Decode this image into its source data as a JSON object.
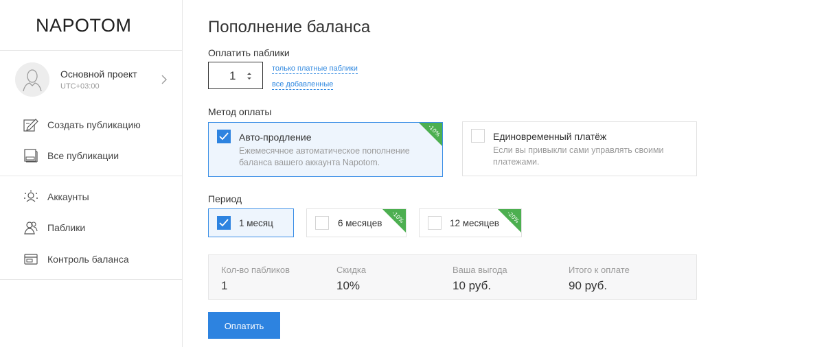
{
  "sidebar": {
    "logo": "NAPOTOM",
    "project": {
      "name": "Основной проект",
      "timezone": "UTC+03:00"
    },
    "nav_top": [
      {
        "label": "Создать публикацию",
        "icon": "edit-icon"
      },
      {
        "label": "Все публикации",
        "icon": "publications-icon"
      }
    ],
    "nav_bottom": [
      {
        "label": "Аккаунты",
        "icon": "accounts-icon"
      },
      {
        "label": "Паблики",
        "icon": "groups-icon"
      },
      {
        "label": "Контроль баланса",
        "icon": "wallet-icon"
      }
    ]
  },
  "main": {
    "title": "Пополнение баланса",
    "publics": {
      "label": "Оплатить паблики",
      "value": "1",
      "link_paid": "только платные паблики",
      "link_all": "все добавленные"
    },
    "method": {
      "label": "Метод оплаты",
      "options": [
        {
          "title": "Авто-продление",
          "desc": "Ежемесячное автоматическое пополнение баланса вашего аккаунта Napotom.",
          "badge": "-10%",
          "selected": true
        },
        {
          "title": "Единовременный платёж",
          "desc": "Если вы привыкли сами управлять своими платежами.",
          "badge": "",
          "selected": false
        }
      ]
    },
    "period": {
      "label": "Период",
      "options": [
        {
          "label": "1 месяц",
          "badge": "",
          "selected": true
        },
        {
          "label": "6 месяцев",
          "badge": "-10%",
          "selected": false
        },
        {
          "label": "12 месяцев",
          "badge": "-20%",
          "selected": false
        }
      ]
    },
    "summary": [
      {
        "label": "Кол-во пабликов",
        "value": "1"
      },
      {
        "label": "Скидка",
        "value": "10%"
      },
      {
        "label": "Ваша выгода",
        "value": "10 руб."
      },
      {
        "label": "Итого к оплате",
        "value": "90 руб."
      }
    ],
    "pay_button": "Оплатить"
  },
  "colors": {
    "accent": "#2d83e0",
    "badge": "#4caf50",
    "selected_bg": "#eef5fd"
  }
}
